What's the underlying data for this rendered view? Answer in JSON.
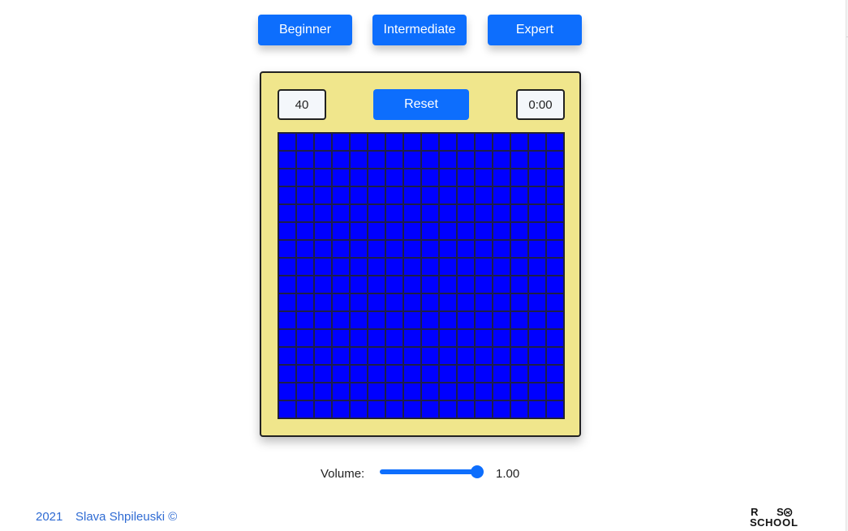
{
  "levels": {
    "beginner_label": "Beginner",
    "intermediate_label": "Intermediate",
    "expert_label": "Expert"
  },
  "game": {
    "mines_remaining": "40",
    "reset_label": "Reset",
    "timer": "0:00",
    "grid": {
      "rows": 16,
      "cols": 16
    },
    "cell_color": "#0000ff",
    "board_color": "#f0e68c"
  },
  "volume": {
    "label": "Volume:",
    "value_text": "1.00",
    "level": 1.0
  },
  "footer": {
    "year": "2021",
    "author": "Slava Shpileuski ©",
    "logo_text": "RS SCHOOL",
    "logo_icon": "rs-school-logo"
  },
  "colors": {
    "accent": "#0d6efd",
    "link": "#2f6bd3"
  }
}
